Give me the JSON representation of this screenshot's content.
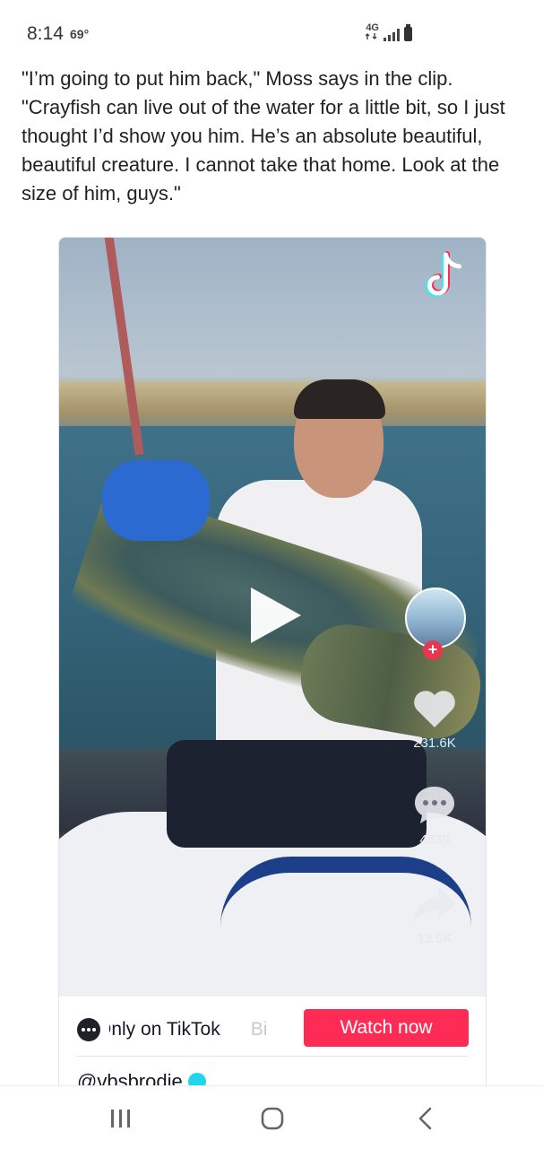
{
  "status_bar": {
    "time": "8:14",
    "temperature": "69°",
    "network": "4G",
    "icons": [
      "lte-icon",
      "signal-icon",
      "battery-icon"
    ]
  },
  "article": {
    "paragraph": "\"I’m going to put him back,\" Moss says in the clip. \"Crayfish can live out of the water for a little bit, so I just thought I’d show you him. He’s an absolute beautiful, beautiful creature. I cannot take that home. Look at the size of him, guys.\""
  },
  "embed": {
    "actions": {
      "like_count": "231.6K",
      "comment_count": "4639",
      "share_count": "13.5K"
    },
    "footer": {
      "marquee_text": "Only on TikTok",
      "marquee_next": "Bi",
      "watch_button": "Watch now",
      "username": "@vbsbrodie"
    },
    "colors": {
      "accent": "#fe2c55",
      "verified": "#20d5ec"
    }
  },
  "nav_bar": {
    "icons": [
      "recents-icon",
      "home-icon",
      "back-icon"
    ]
  }
}
